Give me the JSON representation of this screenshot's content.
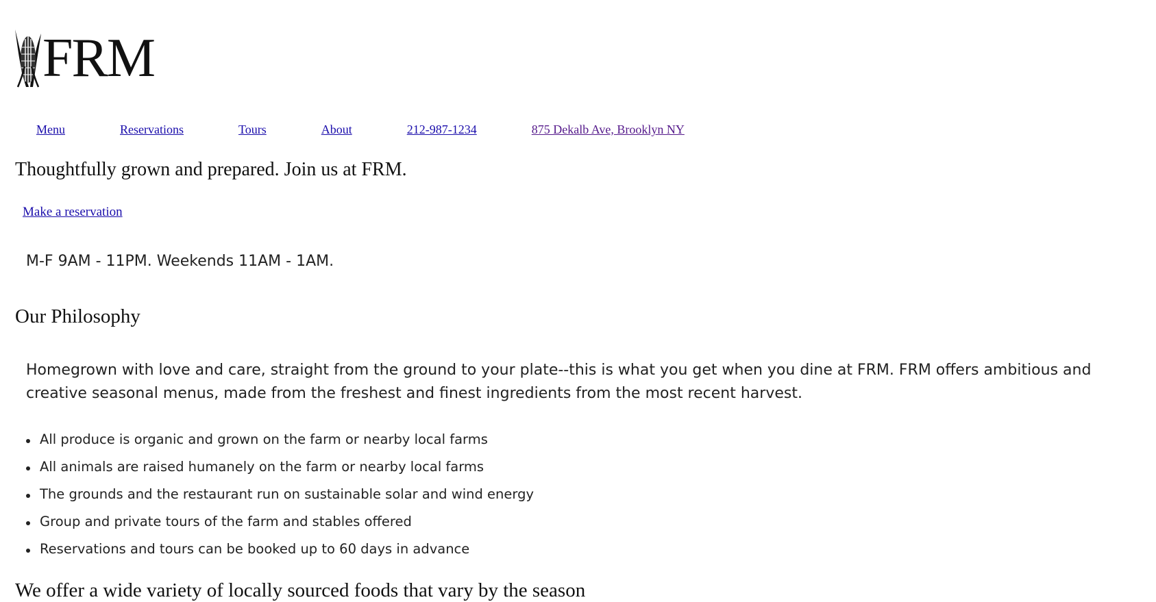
{
  "logo": {
    "text": "FRM",
    "icon": "corn-icon"
  },
  "nav": {
    "items": [
      {
        "label": "Menu"
      },
      {
        "label": "Reservations"
      },
      {
        "label": "Tours"
      },
      {
        "label": "About"
      },
      {
        "label": "212-987-1234"
      },
      {
        "label": "875 Dekalb Ave, Brooklyn NY"
      }
    ]
  },
  "hero": {
    "tagline": "Thoughtfully grown and prepared. Join us at FRM.",
    "reserve_link": "Make a reservation",
    "hours": "M-F 9AM - 11PM. Weekends 11AM - 1AM."
  },
  "philosophy": {
    "heading": "Our Philosophy",
    "text": "Homegrown with love and care, straight from the ground to your plate--this is what you get when you dine at FRM. FRM offers ambitious and creative seasonal menus, made from the freshest and finest ingredients from the most recent harvest.",
    "bullets": [
      "All produce is organic and grown on the farm or nearby local farms",
      "All animals are raised humanely on the farm or nearby local farms",
      "The grounds and the restaurant run on sustainable solar and wind energy",
      "Group and private tours of the farm and stables offered",
      "Reservations and tours can be booked up to 60 days in advance"
    ]
  },
  "season": {
    "heading": "We offer a wide variety of locally sourced foods that vary by the season"
  },
  "colors": {
    "link": "#1a0dab",
    "visited_link": "#551a8b",
    "text": "#111111"
  }
}
